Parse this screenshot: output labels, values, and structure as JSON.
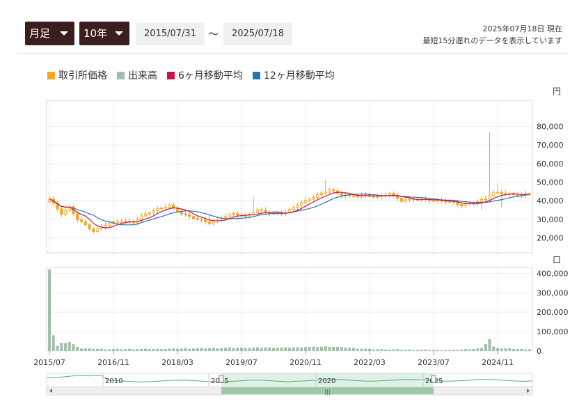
{
  "controls": {
    "period": "月足",
    "range": "10年",
    "start_date": "2015/07/31",
    "separator": "～",
    "end_date": "2025/07/18"
  },
  "notice": {
    "line1": "2025年07月18日 現在",
    "line2": "最短15分遅れのデータを表示しています"
  },
  "colors": {
    "price": "#f5a623",
    "volume": "#9fbfaa",
    "ma6": "#d0104c",
    "ma12": "#1f78b4",
    "navigator": "#4caf7a"
  },
  "chart_data": [
    {
      "type": "candlestick",
      "unit": "円",
      "legend": [
        "取引所価格",
        "出来高",
        "6ヶ月移動平均",
        "12ヶ月移動平均"
      ],
      "y_ticks": [
        20000,
        30000,
        40000,
        50000,
        60000,
        70000,
        80000
      ],
      "y_tick_labels": [
        "20,000",
        "30,000",
        "40,000",
        "50,000",
        "60,000",
        "70,000",
        "80,000"
      ],
      "ylim": [
        12000,
        94000
      ],
      "grid": true,
      "x_ticks": [
        "2015/07",
        "2016/11",
        "2018/03",
        "2019/07",
        "2020/11",
        "2022/03",
        "2023/07",
        "2024/11"
      ],
      "close_anchors": [
        [
          0,
          41000
        ],
        [
          3,
          33000
        ],
        [
          5,
          36500
        ],
        [
          7,
          30000
        ],
        [
          9,
          27000
        ],
        [
          11,
          23500
        ],
        [
          14,
          27000
        ],
        [
          17,
          29000
        ],
        [
          21,
          28500
        ],
        [
          24,
          33000
        ],
        [
          27,
          35500
        ],
        [
          30,
          37500
        ],
        [
          33,
          33000
        ],
        [
          37,
          30000
        ],
        [
          40,
          28000
        ],
        [
          43,
          31000
        ],
        [
          46,
          33000
        ],
        [
          49,
          31500
        ],
        [
          52,
          35000
        ],
        [
          56,
          33000
        ],
        [
          59,
          33500
        ],
        [
          62,
          38000
        ],
        [
          65,
          41000
        ],
        [
          68,
          44000
        ],
        [
          70,
          46000
        ],
        [
          73,
          43000
        ],
        [
          76,
          42500
        ],
        [
          79,
          43000
        ],
        [
          82,
          42000
        ],
        [
          85,
          44000
        ],
        [
          88,
          40000
        ],
        [
          91,
          41000
        ],
        [
          94,
          40500
        ],
        [
          97,
          40000
        ],
        [
          100,
          39500
        ],
        [
          103,
          37500
        ],
        [
          106,
          39000
        ],
        [
          109,
          41000
        ],
        [
          111,
          44500
        ],
        [
          113,
          44000
        ],
        [
          116,
          43000
        ],
        [
          119,
          43500
        ]
      ],
      "high_spikes": {
        "0": 43000,
        "20": 31000,
        "40": 33000,
        "51": 42000,
        "69": 51000,
        "110": 77000,
        "112": 49000
      },
      "low_dips": {
        "108": 35000,
        "113": 36500
      }
    },
    {
      "type": "bar",
      "unit": "口",
      "y_ticks": [
        0,
        100000,
        200000,
        300000,
        400000
      ],
      "y_tick_labels": [
        "0",
        "100,000",
        "200,000",
        "300,000",
        "400,000"
      ],
      "ylim": [
        0,
        430000
      ],
      "volume_anchors": [
        [
          0,
          420000
        ],
        [
          1,
          80000
        ],
        [
          2,
          25000
        ],
        [
          3,
          38000
        ],
        [
          4,
          40000
        ],
        [
          5,
          45000
        ],
        [
          6,
          32000
        ],
        [
          7,
          22000
        ],
        [
          8,
          12000
        ],
        [
          15,
          8000
        ],
        [
          30,
          10000
        ],
        [
          45,
          15000
        ],
        [
          60,
          16000
        ],
        [
          70,
          22000
        ],
        [
          80,
          8000
        ],
        [
          100,
          3000
        ],
        [
          108,
          12000
        ],
        [
          110,
          60000
        ],
        [
          111,
          20000
        ],
        [
          113,
          12000
        ],
        [
          119,
          8000
        ]
      ]
    }
  ],
  "navigator": {
    "years": [
      "2010",
      "2015",
      "2020",
      "2025"
    ],
    "scroll_grip": "|||"
  }
}
